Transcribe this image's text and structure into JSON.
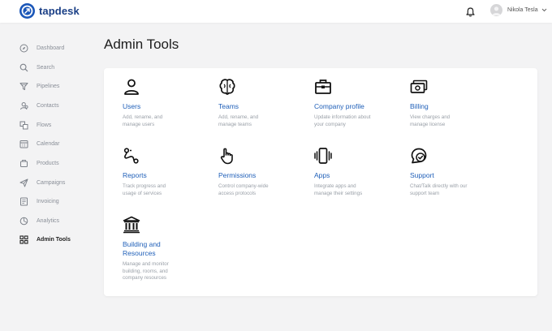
{
  "app": {
    "name": "tapdesk"
  },
  "header": {
    "user_name": "Nikola Tesla"
  },
  "sidebar": {
    "items": [
      {
        "label": "Dashboard",
        "icon": "compass-icon"
      },
      {
        "label": "Search",
        "icon": "search-icon"
      },
      {
        "label": "Pipelines",
        "icon": "filter-icon"
      },
      {
        "label": "Contacts",
        "icon": "contacts-icon"
      },
      {
        "label": "Flows",
        "icon": "flows-icon"
      },
      {
        "label": "Calendar",
        "icon": "calendar-icon"
      },
      {
        "label": "Products",
        "icon": "box-icon"
      },
      {
        "label": "Campaigns",
        "icon": "send-icon"
      },
      {
        "label": "Invoicing",
        "icon": "invoice-icon"
      },
      {
        "label": "Analytics",
        "icon": "pie-chart-icon"
      },
      {
        "label": "Admin Tools",
        "icon": "grid-icon",
        "active": true
      }
    ]
  },
  "main": {
    "title": "Admin Tools",
    "tools": [
      {
        "title": "Users",
        "desc": "Add, rename, and manage users",
        "icon": "user-icon"
      },
      {
        "title": "Teams",
        "desc": "Add, rename, and manage teams",
        "icon": "brain-icon"
      },
      {
        "title": "Company profile",
        "desc": "Update information about your company",
        "icon": "briefcase-icon"
      },
      {
        "title": "Billing",
        "desc": "View charges and manage license",
        "icon": "money-icon"
      },
      {
        "title": "Reports",
        "desc": "Track progress and usage of services",
        "icon": "route-icon"
      },
      {
        "title": "Permissions",
        "desc": "Control company-wide access protocols",
        "icon": "hand-pointer-icon"
      },
      {
        "title": "Apps",
        "desc": "Integrate apps and manage their settings",
        "icon": "phone-vibrate-icon"
      },
      {
        "title": "Support",
        "desc": "Chat/Talk directly with our support team",
        "icon": "chat-check-icon"
      },
      {
        "title": "Building and Resources",
        "desc": "Manage and monitor building, rooms, and company resources",
        "icon": "bank-icon"
      }
    ]
  },
  "colors": {
    "brand": "#1a56b8",
    "link": "#1f5fb8",
    "muted": "#8a8f98",
    "background": "#f3f3f4"
  }
}
